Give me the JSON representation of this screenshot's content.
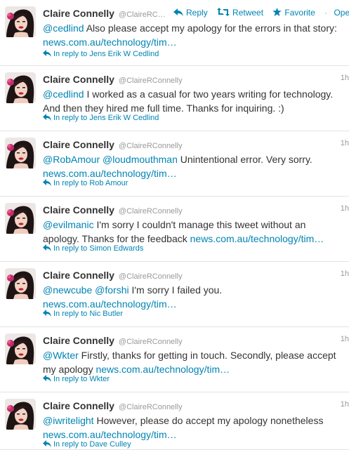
{
  "tweets": [
    {
      "name": "Claire Connelly",
      "handle": "@ClaireRC…",
      "time": "",
      "actions": {
        "reply": "Reply",
        "retweet": "Retweet",
        "favorite": "Favorite",
        "open": "Open"
      },
      "segments": [
        {
          "t": "mention",
          "v": "@cedlind"
        },
        {
          "t": "text",
          "v": " Also please accept my apology for the errors in that story: "
        },
        {
          "t": "link",
          "v": "news.com.au/technology/tim…"
        }
      ],
      "reply_to": "In reply to Jens Erik W Cedlind"
    },
    {
      "name": "Claire Connelly",
      "handle": "@ClaireRConnelly",
      "time": "1h",
      "segments": [
        {
          "t": "mention",
          "v": "@cedlind"
        },
        {
          "t": "text",
          "v": " I worked as a casual for two years writing for technology. And then they hired me full time. Thanks for inquiring. :)"
        }
      ],
      "reply_to": "In reply to Jens Erik W Cedlind"
    },
    {
      "name": "Claire Connelly",
      "handle": "@ClaireRConnelly",
      "time": "1h",
      "segments": [
        {
          "t": "mention",
          "v": "@RobAmour"
        },
        {
          "t": "text",
          "v": " "
        },
        {
          "t": "mention",
          "v": "@loudmouthman"
        },
        {
          "t": "text",
          "v": " Unintentional error. Very sorry. "
        },
        {
          "t": "link",
          "v": "news.com.au/technology/tim…"
        }
      ],
      "reply_to": "In reply to Rob Amour"
    },
    {
      "name": "Claire Connelly",
      "handle": "@ClaireRConnelly",
      "time": "1h",
      "segments": [
        {
          "t": "mention",
          "v": "@evilmanic"
        },
        {
          "t": "text",
          "v": " I'm sorry I couldn't manage this tweet without an apology. Thanks for the feedback "
        },
        {
          "t": "link",
          "v": "news.com.au/technology/tim…"
        }
      ],
      "reply_to": "In reply to Simon Edwards"
    },
    {
      "name": "Claire Connelly",
      "handle": "@ClaireRConnelly",
      "time": "1h",
      "segments": [
        {
          "t": "mention",
          "v": "@newcube"
        },
        {
          "t": "text",
          "v": " "
        },
        {
          "t": "mention",
          "v": "@forshi"
        },
        {
          "t": "text",
          "v": " I'm sorry I failed you. "
        },
        {
          "t": "link",
          "v": "news.com.au/technology/tim…"
        }
      ],
      "reply_to": "In reply to Nic Butler"
    },
    {
      "name": "Claire Connelly",
      "handle": "@ClaireRConnelly",
      "time": "1h",
      "segments": [
        {
          "t": "mention",
          "v": "@Wkter"
        },
        {
          "t": "text",
          "v": " Firstly, thanks for getting in touch. Secondly, please accept my apology "
        },
        {
          "t": "link",
          "v": "news.com.au/technology/tim…"
        }
      ],
      "reply_to": "In reply to Wkter"
    },
    {
      "name": "Claire Connelly",
      "handle": "@ClaireRConnelly",
      "time": "1h",
      "segments": [
        {
          "t": "mention",
          "v": "@iwritelight"
        },
        {
          "t": "text",
          "v": " However, please do accept my apology nonetheless "
        },
        {
          "t": "link",
          "v": "news.com.au/technology/tim…"
        }
      ],
      "reply_to": "In reply to Dave Culley"
    }
  ],
  "colors": {
    "link": "#0084b4",
    "text": "#333333",
    "muted": "#999999",
    "divider": "#e3e3e3"
  },
  "icons": {
    "reply": "reply-arrow-icon",
    "retweet": "retweet-icon",
    "favorite": "star-icon",
    "avatar": "profile-photo"
  }
}
